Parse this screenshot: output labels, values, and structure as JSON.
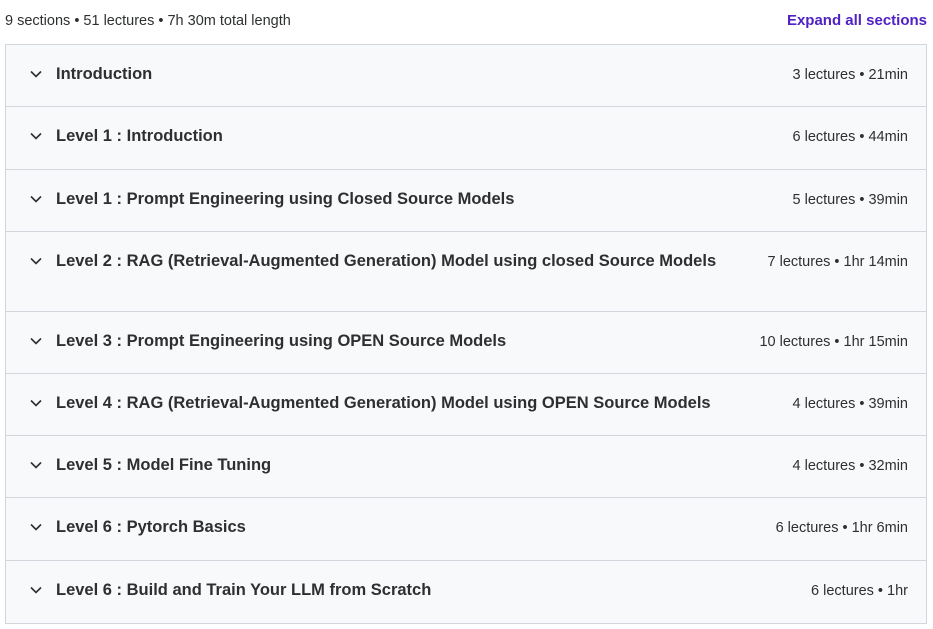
{
  "curriculum": {
    "summary": "9 sections • 51 lectures • 7h 30m total length",
    "expand_label": "Expand all sections",
    "accent_color": "#5022c3",
    "row_icon": "chevron-down-icon",
    "sections": [
      {
        "title": "Introduction",
        "meta": "3 lectures • 21min"
      },
      {
        "title": "Level 1 : Introduction",
        "meta": "6 lectures • 44min"
      },
      {
        "title": "Level 1 : Prompt Engineering using Closed Source Models",
        "meta": "5 lectures • 39min"
      },
      {
        "title": "Level 2 : RAG (Retrieval-Augmented Generation) Model using closed Source Models",
        "meta": "7 lectures • 1hr 14min"
      },
      {
        "title": "Level 3 : Prompt Engineering using OPEN Source Models",
        "meta": "10 lectures • 1hr 15min"
      },
      {
        "title": "Level 4 : RAG (Retrieval-Augmented Generation) Model using OPEN Source Models",
        "meta": "4 lectures • 39min"
      },
      {
        "title": "Level 5 : Model Fine Tuning",
        "meta": "4 lectures • 32min"
      },
      {
        "title": "Level 6 : Pytorch Basics",
        "meta": "6 lectures • 1hr 6min"
      },
      {
        "title": "Level 6 : Build and Train Your LLM from Scratch",
        "meta": "6 lectures • 1hr"
      }
    ]
  }
}
